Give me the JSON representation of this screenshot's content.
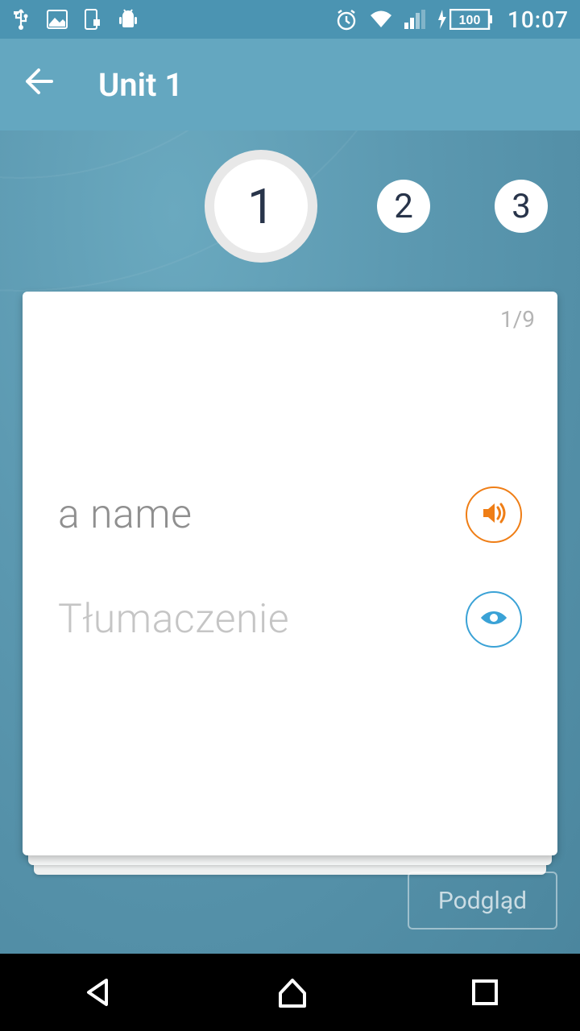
{
  "status": {
    "time": "10:07",
    "battery": "100"
  },
  "header": {
    "title": "Unit 1"
  },
  "steps": {
    "items": [
      "1",
      "2",
      "3"
    ],
    "active_index": 0
  },
  "card": {
    "counter": "1/9",
    "word": "a name",
    "translation_placeholder": "Tłumaczenie"
  },
  "preview_button": "Podgląd"
}
